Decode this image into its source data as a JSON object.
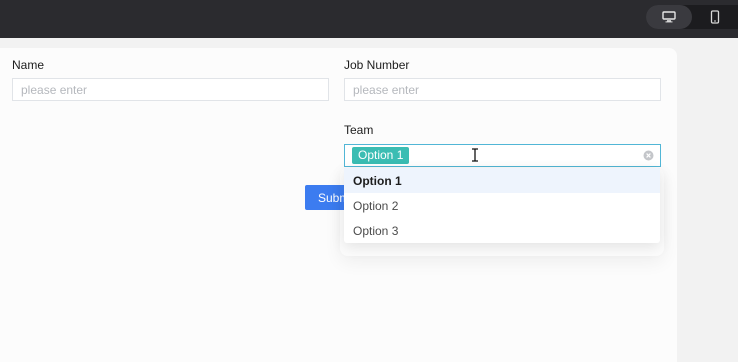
{
  "device_switch": {
    "desktop_icon": "monitor-icon",
    "mobile_icon": "phone-icon"
  },
  "form": {
    "name": {
      "label": "Name",
      "placeholder": "please enter"
    },
    "job_number": {
      "label": "Job Number",
      "placeholder": "please enter"
    },
    "team": {
      "label": "Team",
      "selected_tag": "Option 1",
      "clear_icon": "clear-circle-icon"
    },
    "submit_label": "Subm"
  },
  "dropdown": {
    "options": [
      "Option 1",
      "Option 2",
      "Option 3"
    ],
    "selected_index": 0
  },
  "colors": {
    "tag": "#3bbdb3",
    "submit": "#3c7cf0",
    "focus_border": "#51b6d6",
    "topbar": "#2b2b2f"
  }
}
